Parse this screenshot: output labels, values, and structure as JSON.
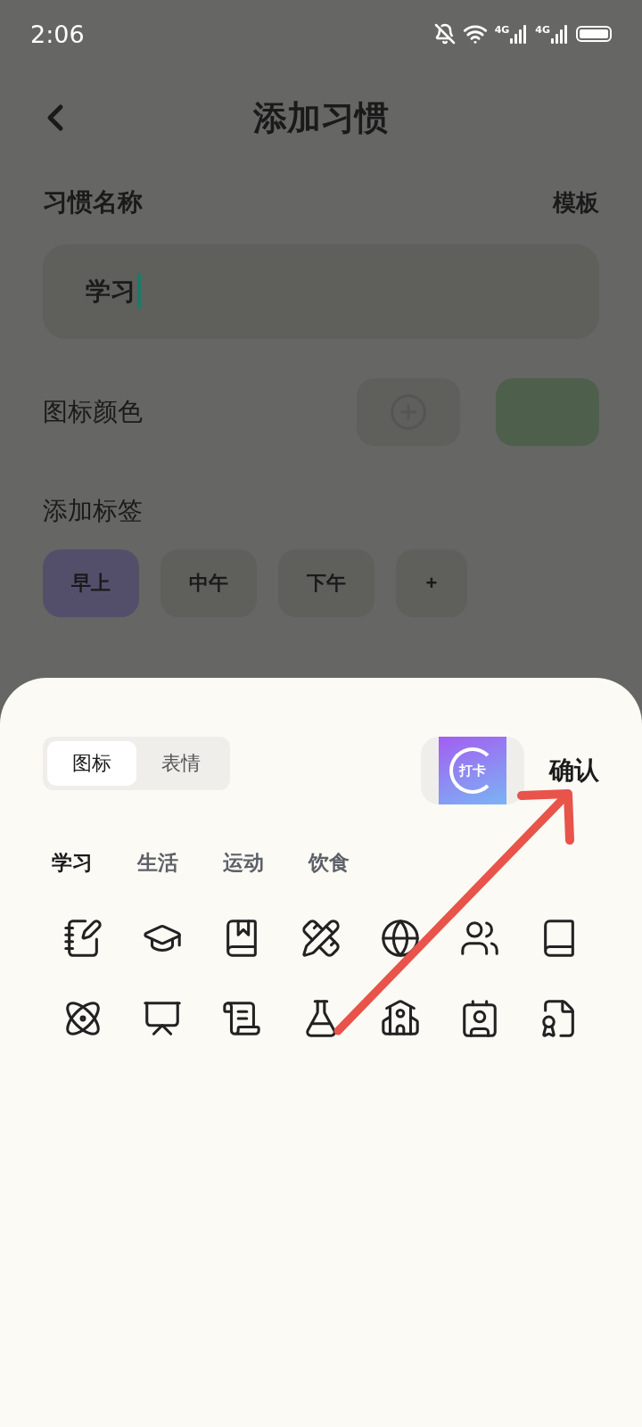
{
  "status_bar": {
    "time": "2:06",
    "networks": [
      "4G",
      "4G"
    ]
  },
  "header": {
    "title": "添加习惯"
  },
  "name_section": {
    "label": "习惯名称",
    "template_link": "模板",
    "value": "学习"
  },
  "icon_color": {
    "label": "图标颜色",
    "color": "#4e604b"
  },
  "tags": {
    "label": "添加标签",
    "items": [
      {
        "label": "早上",
        "selected": true
      },
      {
        "label": "中午",
        "selected": false
      },
      {
        "label": "下午",
        "selected": false
      },
      {
        "label": "+",
        "selected": false
      }
    ]
  },
  "sheet": {
    "tabs": [
      {
        "label": "图标",
        "selected": true
      },
      {
        "label": "表情",
        "selected": false
      }
    ],
    "preview_text": "打卡",
    "confirm": "确认",
    "categories": [
      {
        "label": "学习",
        "selected": true
      },
      {
        "label": "生活",
        "selected": false
      },
      {
        "label": "运动",
        "selected": false
      },
      {
        "label": "饮食",
        "selected": false
      }
    ],
    "icons": [
      {
        "kind": "notebook"
      },
      {
        "kind": "cap"
      },
      {
        "kind": "bookmark"
      },
      {
        "kind": "ruler"
      },
      {
        "kind": "globe"
      },
      {
        "kind": "group"
      },
      {
        "kind": "book"
      },
      {
        "kind": "atom"
      },
      {
        "kind": "easel"
      },
      {
        "kind": "scroll"
      },
      {
        "kind": "flask"
      },
      {
        "kind": "school"
      },
      {
        "kind": "badge"
      },
      {
        "kind": "certificate"
      }
    ]
  },
  "annotation": {
    "kind": "arrow",
    "color": "#e8534a"
  }
}
